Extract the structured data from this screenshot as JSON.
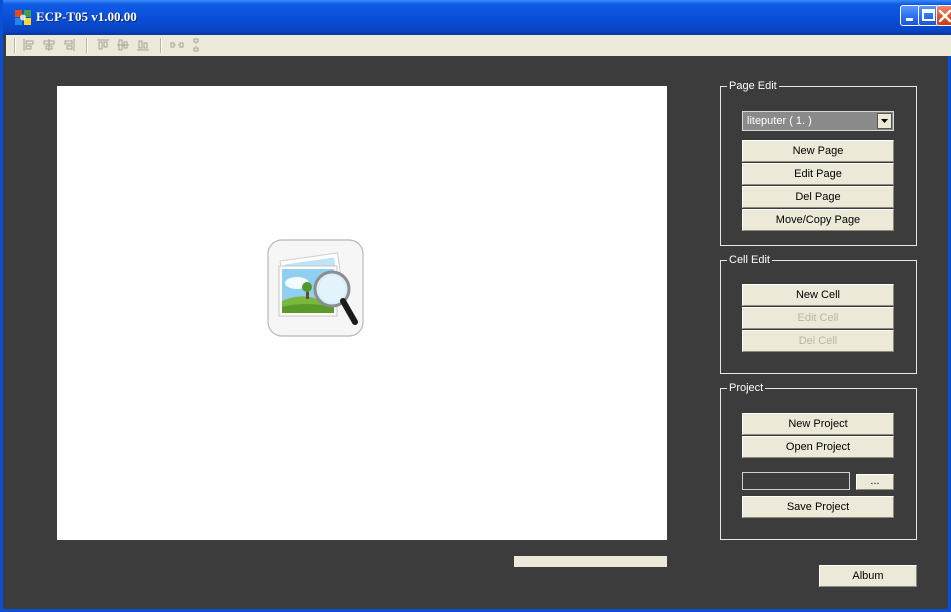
{
  "window": {
    "title": "ECP-T05 v1.00.00",
    "title_color": "#0a4fd8",
    "background": "#3c3c3c",
    "controls": [
      "minimize-icon",
      "maximize-icon",
      "close-icon"
    ]
  },
  "toolbar": {
    "icons": [
      "align-left-icon",
      "align-center-icon",
      "align-right-icon",
      "align-top-icon",
      "align-middle-icon",
      "align-bottom-icon",
      "distribute-horizontal-icon",
      "distribute-vertical-icon"
    ]
  },
  "canvas": {
    "placeholder_icon": "image-search-icon"
  },
  "page_edit": {
    "title": "Page Edit",
    "page_select_value": "liteputer   ( 1. )",
    "new_page": "New Page",
    "edit_page": "Edit Page",
    "del_page": "Del Page",
    "move_copy_page": "Move/Copy Page"
  },
  "cell_edit": {
    "title": "Cell Edit",
    "new_cell": "New Cell",
    "edit_cell": "Edit Cell",
    "del_cell": "Del Cell"
  },
  "project": {
    "title": "Project",
    "new_project": "New Project",
    "open_project": "Open Project",
    "path_value": "",
    "browse": "...",
    "save_project": "Save Project"
  },
  "album": "Album"
}
